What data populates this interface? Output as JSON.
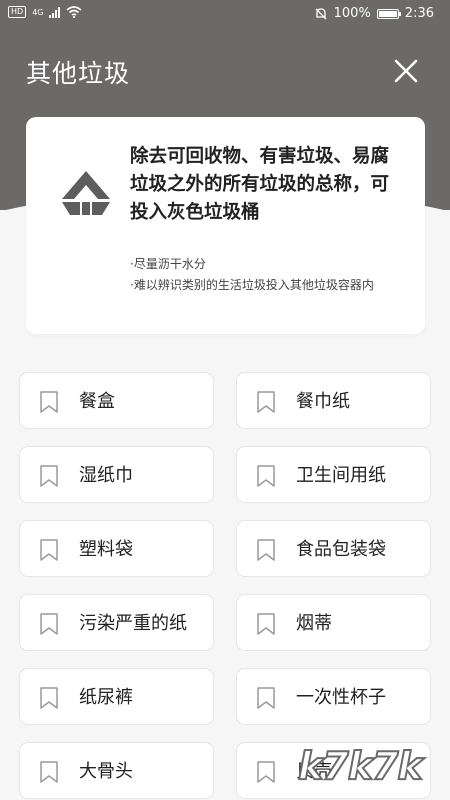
{
  "status": {
    "hd": "HD",
    "network": "4G",
    "battery": "100%",
    "battery_level": 1.0,
    "time": "2:36",
    "icons": [
      "signal-icon",
      "wifi-icon",
      "mute-icon",
      "battery-icon"
    ]
  },
  "header": {
    "title": "其他垃圾",
    "close_icon": "close-icon"
  },
  "card": {
    "icon": "residual-waste-icon",
    "description": "除去可回收物、有害垃圾、易腐垃圾之外的所有垃圾的总称，可投入灰色垃圾桶",
    "tips": [
      "·尽量沥干水分",
      "·难以辨识类别的生活垃圾投入其他垃圾容器内"
    ]
  },
  "items": [
    {
      "label": "餐盒"
    },
    {
      "label": "餐巾纸"
    },
    {
      "label": "湿纸巾"
    },
    {
      "label": "卫生间用纸"
    },
    {
      "label": "塑料袋"
    },
    {
      "label": "食品包装袋"
    },
    {
      "label": "污染严重的纸"
    },
    {
      "label": "烟蒂"
    },
    {
      "label": "纸尿裤"
    },
    {
      "label": "一次性杯子"
    },
    {
      "label": "大骨头"
    },
    {
      "label": "贝壳"
    }
  ],
  "watermark": "k7k7k",
  "colors": {
    "header": "#6b6a69",
    "background": "#f6f6f6",
    "card": "#ffffff",
    "icon": "#5d5d5d"
  }
}
